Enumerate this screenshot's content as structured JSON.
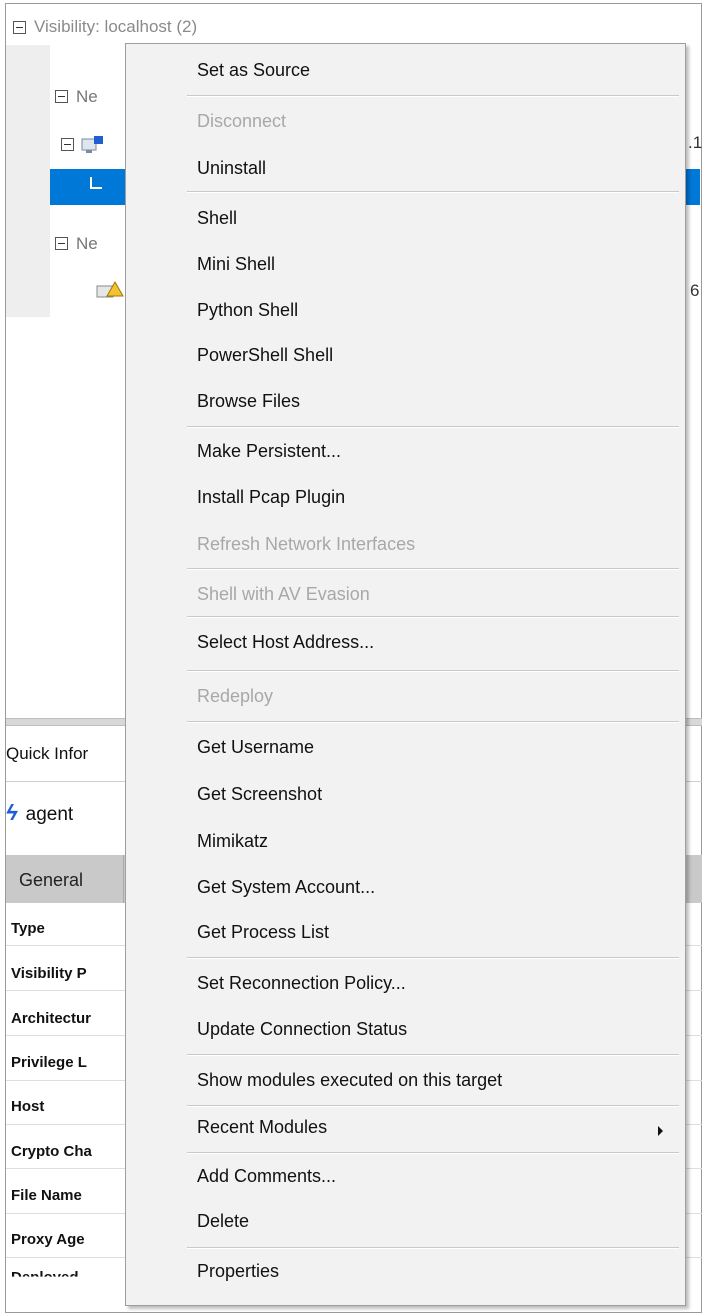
{
  "tree": {
    "title": "Visibility: localhost (2)",
    "node1_partial": "Ne",
    "node2_partial": "Ne",
    "right_edge_1": ".1",
    "right_edge_2": "6"
  },
  "quick_info": {
    "header_partial": "Quick Infor",
    "agent_partial": "agent",
    "tab_general": "General",
    "properties": [
      "Type",
      "Visibility P",
      "Architectur",
      "Privilege L",
      "Host",
      "Crypto Cha",
      "File Name",
      "Proxy Age",
      "Deployed"
    ]
  },
  "context_menu": {
    "items": [
      {
        "label": "Set as Source",
        "disabled": false
      },
      {
        "label": "Disconnect",
        "disabled": true
      },
      {
        "label": "Uninstall",
        "disabled": false
      },
      {
        "label": "Shell",
        "disabled": false
      },
      {
        "label": "Mini Shell",
        "disabled": false
      },
      {
        "label": "Python Shell",
        "disabled": false
      },
      {
        "label": "PowerShell Shell",
        "disabled": false
      },
      {
        "label": "Browse Files",
        "disabled": false
      },
      {
        "label": "Make Persistent...",
        "disabled": false
      },
      {
        "label": "Install Pcap Plugin",
        "disabled": false
      },
      {
        "label": "Refresh Network Interfaces",
        "disabled": true
      },
      {
        "label": "Shell with AV Evasion",
        "disabled": true
      },
      {
        "label": "Select Host Address...",
        "disabled": false
      },
      {
        "label": "Redeploy",
        "disabled": true
      },
      {
        "label": "Get Username",
        "disabled": false
      },
      {
        "label": "Get Screenshot",
        "disabled": false
      },
      {
        "label": "Mimikatz",
        "disabled": false
      },
      {
        "label": "Get System Account...",
        "disabled": false
      },
      {
        "label": "Get Process List",
        "disabled": false
      },
      {
        "label": "Set Reconnection Policy...",
        "disabled": false
      },
      {
        "label": "Update Connection Status",
        "disabled": false
      },
      {
        "label": "Show modules executed on this target",
        "disabled": false
      },
      {
        "label": "Recent Modules",
        "disabled": false,
        "submenu": true
      },
      {
        "label": "Add Comments...",
        "disabled": false
      },
      {
        "label": "Delete",
        "disabled": false
      },
      {
        "label": "Properties",
        "disabled": false
      }
    ]
  },
  "colors": {
    "selection": "#0078d7",
    "menu_bg": "#f2f2f2",
    "disabled_text": "#a8a8a8"
  }
}
